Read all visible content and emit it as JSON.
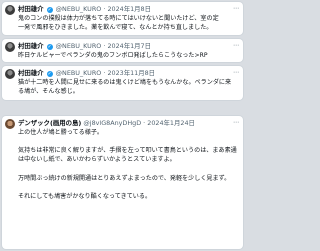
{
  "posts": [
    {
      "author": "村田雄介",
      "handle": "@NEBU_KURO",
      "separator": "·",
      "date": "2024年1月8日",
      "lines": [
        "鬼のコンの撲殺は体力が落ちてる時にてはいけないと聞いたけど、室の定",
        "一発で風邪をひきました。薬を飲んで寝て、なんとか持ち直しました。"
      ]
    },
    {
      "author": "村田雄介",
      "handle": "@NEBU_KURO",
      "separator": "·",
      "date": "2024年1月7日",
      "lines": [
        "昨日ケルビャーでペランダの鬼のフンボロ発ばしたらこうなった>RP"
      ]
    },
    {
      "author": "村田雄介",
      "handle": "@NEBU_KURO",
      "separator": "·",
      "date": "2023年11月8日",
      "lines": [
        "猫が十二時を人間に見せに来るのは鬼くけど鳩をもうなんかな。ペランダに来",
        "る鳩が、そんな感じ。"
      ]
    },
    {
      "author": "デンザック(画用の島)",
      "handle": "@j8vlG8AnyDHgD",
      "separator": "·",
      "date": "2024年1月24日",
      "paragraphs": [
        [
          "上の住人が鳩と勝ってる様子。"
        ],
        [],
        [
          "気持ちは非常に良く解りますが、手摺を左って叩いて書鳥というのは、まあ素通",
          "は中ないし紙で、あいかわらずいかようとスていますよ。"
        ],
        [],
        [
          "万時間ぶっ続けの新規開通はとりあえずよまったので、発軽を少しく見まず。"
        ],
        [],
        [
          "それにしても鳩害がかなり酷くなってきている。"
        ]
      ]
    }
  ]
}
